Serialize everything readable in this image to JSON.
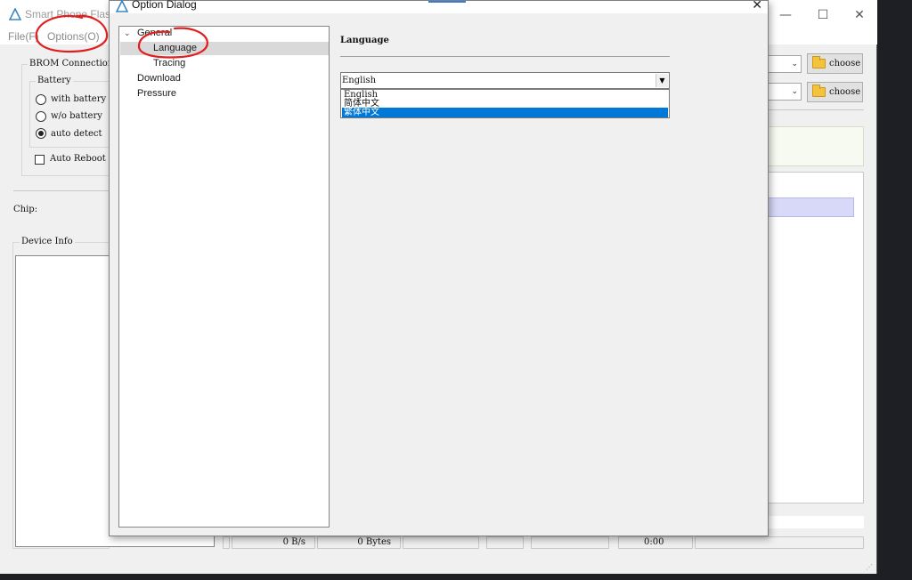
{
  "main_window": {
    "title": "Smart Phone Flash",
    "menu": [
      "File(F)",
      "Options(O)"
    ],
    "brom_connection": {
      "title": "BROM Connection",
      "battery_group": "Battery",
      "options": [
        "with battery",
        "w/o battery",
        "auto detect"
      ],
      "selected_option": "auto detect",
      "auto_reboot_label": "Auto Reboot",
      "auto_reboot_checked": false
    },
    "chip_label": "Chip:",
    "device_info_label": "Device Info",
    "choose_label": "choose",
    "status_bar": {
      "speed": "0 B/s",
      "bytes": "0 Bytes",
      "time": "0:00"
    }
  },
  "option_dialog": {
    "title": "Option Dialog",
    "tree": {
      "general": "General",
      "language": "Language",
      "tracing": "Tracing",
      "download": "Download",
      "pressure": "Pressure"
    },
    "selected_node": "Language",
    "page_heading": "Language",
    "language_combo": {
      "value": "English",
      "options": [
        "English",
        "简体中文",
        "繁体中文"
      ],
      "highlighted_option": "繁体中文"
    }
  },
  "colors": {
    "selection_blue": "#0078d7",
    "annotation_red": "#e01f1f",
    "folder_yellow": "#f5c33b"
  }
}
